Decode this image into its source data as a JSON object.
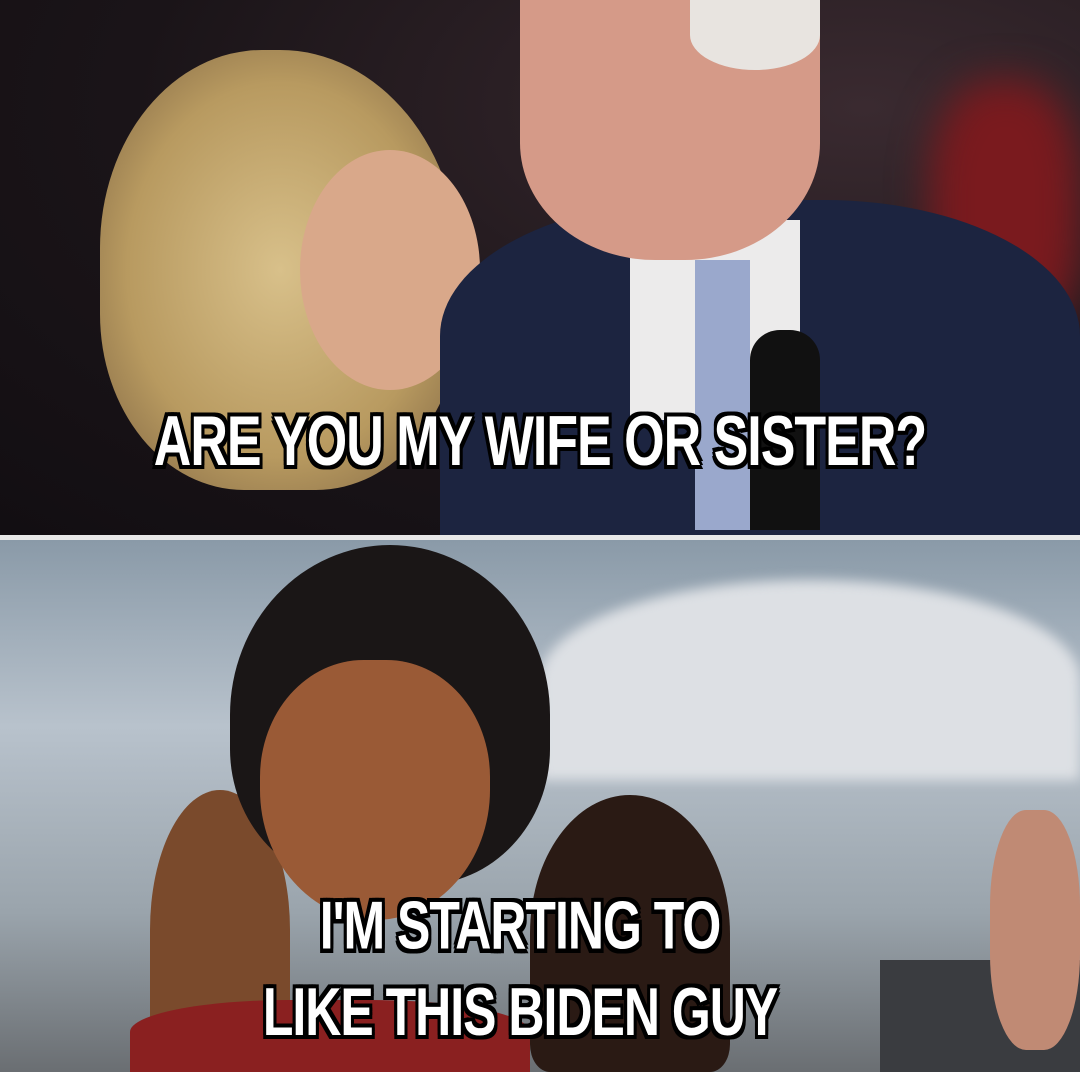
{
  "meme": {
    "top_caption": "ARE YOU MY WIFE OR SISTER?",
    "bottom_caption_line1": "I'M STARTING TO",
    "bottom_caption_line2": "LIKE THIS BIDEN GUY"
  },
  "colors": {
    "caption_fill": "#ffffff",
    "caption_outline": "#000000",
    "divider": "#e8e8e8"
  }
}
